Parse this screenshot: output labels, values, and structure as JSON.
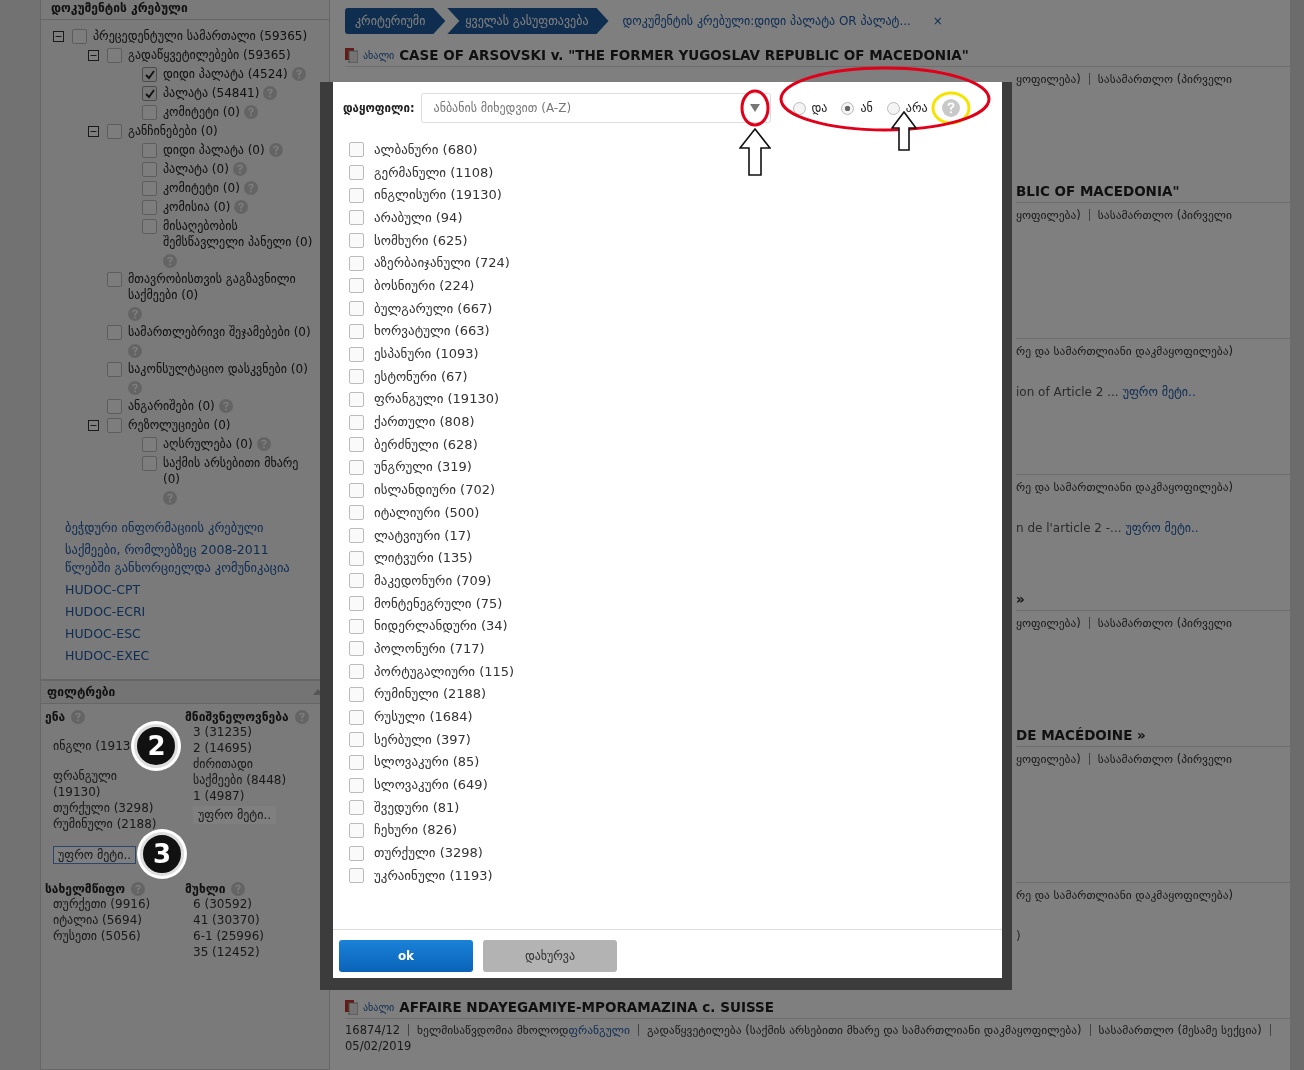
{
  "sidebar": {
    "collection_title": "დოკუმენტის კრებული",
    "tree": [
      {
        "label": "პრეცედენტული სამართალი (59365)",
        "checked": false,
        "help": false,
        "expanded": true,
        "children": [
          {
            "label": "გადაწყვეტილებები (59365)",
            "checked": false,
            "help": false,
            "expanded": true,
            "children": [
              {
                "label": "დიდი პალატა (4524)",
                "checked": true,
                "help": true
              },
              {
                "label": "პალატა (54841)",
                "checked": true,
                "help": true
              },
              {
                "label": "კომიტეტი (0)",
                "checked": false,
                "help": true
              }
            ]
          },
          {
            "label": "განჩინებები (0)",
            "checked": false,
            "help": false,
            "expanded": true,
            "children": [
              {
                "label": "დიდი პალატა (0)",
                "checked": false,
                "help": true
              },
              {
                "label": "პალატა (0)",
                "checked": false,
                "help": true
              },
              {
                "label": "კომიტეტი (0)",
                "checked": false,
                "help": true
              },
              {
                "label": "კომისია (0)",
                "checked": false,
                "help": true
              },
              {
                "label": "მისაღებობის შემსწავლელი პანელი (0)",
                "checked": false,
                "help": true
              }
            ]
          },
          {
            "label": "მთავრობისთვის გაგზავნილი საქმეები (0)",
            "checked": false,
            "help": true
          },
          {
            "label": "სამართლებრივი შეჯამებები (0)",
            "checked": false,
            "help": true
          },
          {
            "label": "საკონსულტაციო დასკვნები (0)",
            "checked": false,
            "help": true
          },
          {
            "label": "ანგარიშები (0)",
            "checked": false,
            "help": true
          },
          {
            "label": "რეზოლუციები (0)",
            "checked": false,
            "help": false,
            "expanded": true,
            "children": [
              {
                "label": "აღსრულება (0)",
                "checked": false,
                "help": true
              },
              {
                "label": "საქმის არსებითი მხარე (0)",
                "checked": false,
                "help": true
              }
            ]
          }
        ]
      }
    ],
    "links": [
      "ბეჭდური ინფორმაციის კრებული",
      "საქმეები, რომლებზეც 2008-2011 წლებში განხორციელდა კომუნიკაცია",
      "HUDOC-CPT",
      "HUDOC-ECRI",
      "HUDOC-ESC",
      "HUDOC-EXEC"
    ],
    "filters": {
      "title": "ფილტრები",
      "groups": [
        {
          "title": "ენა",
          "items": [
            {
              "text": "ინგლი (1913",
              "badge": "2"
            },
            {
              "text": "ფრანგული (19130)"
            },
            {
              "text": "თურქული (3298)"
            },
            {
              "text": "რუმინული (2188)"
            }
          ],
          "more": "უფრო მეტი..",
          "more_focused": true,
          "more_badge": "3"
        },
        {
          "title": "მნიშვნელოვნება",
          "items": [
            {
              "text": "3 (31235)"
            },
            {
              "text": "2 (14695)"
            },
            {
              "text": "ძირითადი საქმეები (8448)"
            },
            {
              "text": "1 (4987)"
            }
          ],
          "more": "უფრო მეტი..",
          "more_focused": false
        },
        {
          "title": "სახელმწიფო",
          "items": [
            {
              "text": "თურქეთი (9916)"
            },
            {
              "text": "იტალია (5694)"
            },
            {
              "text": "რუსეთი (5056)"
            }
          ]
        },
        {
          "title": "მუხლი",
          "items": [
            {
              "text": "6 (30592)"
            },
            {
              "text": "41 (30370)"
            },
            {
              "text": "6-1 (25996)"
            },
            {
              "text": "35 (12452)"
            }
          ]
        }
      ]
    }
  },
  "breadcrumb": {
    "crumbs": [
      "კრიტერიუმი",
      "ყველას გასუფთავება"
    ],
    "query": "დოკუმენტის კრებული:დიდი პალატა OR პალატ...",
    "remove": "×"
  },
  "results": [
    {
      "kind": "covered",
      "new_tag": "ახალი",
      "title": "CASE OF ARSOVSKI v. \"THE FORMER YUGOSLAV REPUBLIC OF MACEDONIA\"",
      "meta": [
        {
          "text": "ყოფილება)"
        },
        {
          "text": "სასამართლო (პირველი"
        }
      ]
    },
    {
      "kind": "covered",
      "title": "BLIC OF MACEDONIA\"",
      "meta": [
        {
          "text": "ყოფილება)"
        },
        {
          "text": "სასამართლო (პირველი"
        }
      ]
    },
    {
      "kind": "covered",
      "meta": [
        {
          "text": "რე და სამართლიანი დაკმაყოფილება)"
        }
      ],
      "snippet": "ion of Article 2 ...",
      "more": "უფრო მეტი.."
    },
    {
      "kind": "covered",
      "meta": [
        {
          "text": "რე და სამართლიანი დაკმაყოფილება)"
        }
      ],
      "snippet": "n de l'article 2 -...",
      "more": "უფრო მეტი.."
    },
    {
      "kind": "covered",
      "title": "»",
      "meta": [
        {
          "text": "ყოფილება)"
        },
        {
          "text": "სასამართლო (პირველი"
        }
      ]
    },
    {
      "kind": "covered",
      "title": "DE MACÉDOINE »",
      "meta": [
        {
          "text": "ყოფილება)"
        },
        {
          "text": "სასამართლო (პირველი"
        }
      ]
    },
    {
      "kind": "covered",
      "meta": [
        {
          "text": "რე და სამართლიანი დაკმაყოფილება)"
        }
      ],
      "snippet": ")"
    },
    {
      "kind": "visible",
      "new_tag": "ახალი",
      "title": "AFFAIRE NDAYEGAMIYE-MPORAMAZINA c. SUISSE",
      "meta": [
        {
          "text": "16874/12"
        },
        {
          "text": "ხელმისაწვდომია მხოლოდ",
          "link": "ფრანგული"
        },
        {
          "text": "გადაწყვეტილება (საქმის არსებითი მხარე და სამართლიანი დაკმაყოფილება)"
        },
        {
          "text": "სასამართლო (მესამე სექცია)"
        },
        {
          "text": "05/02/2019"
        }
      ]
    }
  ],
  "modal": {
    "sort_label": "დაყოფილი:",
    "sort_value": "ანბანის მიხედვით (A-Z)",
    "operators": [
      {
        "label": "და",
        "selected": false
      },
      {
        "label": "ან",
        "selected": true
      },
      {
        "label": "არა",
        "selected": false
      }
    ],
    "items": [
      {
        "label": "ალბანური (680)",
        "checked": false
      },
      {
        "label": "გერმანული (1108)",
        "checked": false
      },
      {
        "label": "ინგლისური (19130)",
        "checked": false
      },
      {
        "label": "არაბული (94)",
        "checked": false
      },
      {
        "label": "სომხური (625)",
        "checked": false
      },
      {
        "label": "აზერბაიჯანული (724)",
        "checked": false
      },
      {
        "label": "ბოსნიური (224)",
        "checked": false
      },
      {
        "label": "ბულგარული (667)",
        "checked": false
      },
      {
        "label": "ხორვატული (663)",
        "checked": false
      },
      {
        "label": "ესპანური (1093)",
        "checked": false
      },
      {
        "label": "ესტონური (67)",
        "checked": false
      },
      {
        "label": "ფრანგული (19130)",
        "checked": false
      },
      {
        "label": "ქართული (808)",
        "checked": false
      },
      {
        "label": "ბერძნული (628)",
        "checked": false
      },
      {
        "label": "უნგრული (319)",
        "checked": false
      },
      {
        "label": "ისლანდიური (702)",
        "checked": false
      },
      {
        "label": "იტალიური (500)",
        "checked": false
      },
      {
        "label": "ლატვიური (17)",
        "checked": false
      },
      {
        "label": "ლიტვური (135)",
        "checked": false
      },
      {
        "label": "მაკედონური (709)",
        "checked": false
      },
      {
        "label": "მონტენეგრული (75)",
        "checked": false
      },
      {
        "label": "ნიდერლანდური (34)",
        "checked": false
      },
      {
        "label": "პოლონური (717)",
        "checked": false
      },
      {
        "label": "პორტუგალიური (115)",
        "checked": false
      },
      {
        "label": "რუმინული (2188)",
        "checked": false
      },
      {
        "label": "რუსული (1684)",
        "checked": false
      },
      {
        "label": "სერბული (397)",
        "checked": false
      },
      {
        "label": "სლოვაკური (85)",
        "checked": false
      },
      {
        "label": "სლოვაკური (649)",
        "checked": false
      },
      {
        "label": "შვედური (81)",
        "checked": false
      },
      {
        "label": "ჩეხური (826)",
        "checked": false
      },
      {
        "label": "თურქული (3298)",
        "checked": false
      },
      {
        "label": "უკრაინული (1193)",
        "checked": false
      }
    ],
    "buttons": [
      {
        "label": "ok",
        "kind": "primary"
      },
      {
        "label": "დახურვა",
        "kind": "secondary"
      }
    ]
  }
}
